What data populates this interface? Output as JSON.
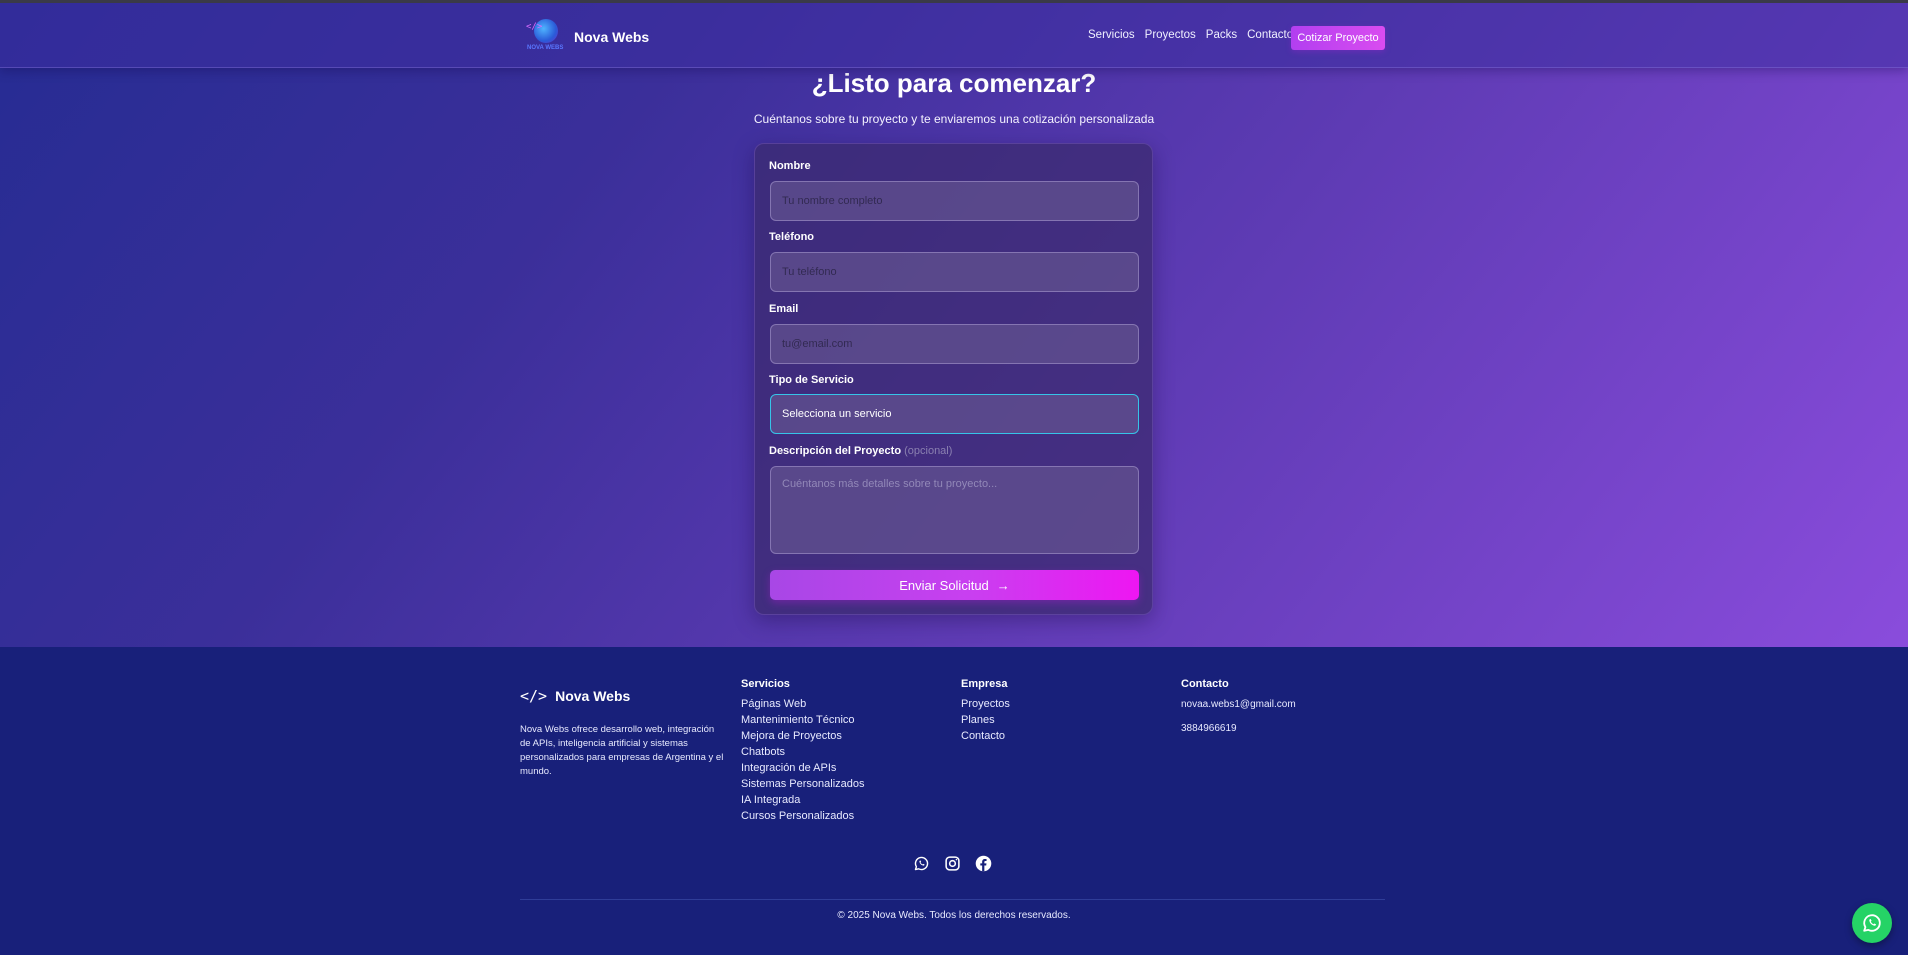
{
  "nav": {
    "brand_name": "Nova Webs",
    "logo_code_glyph": "</>",
    "logo_text": "NOVA WEBS",
    "links": [
      {
        "label": "Servicios"
      },
      {
        "label": "Proyectos"
      },
      {
        "label": "Packs"
      },
      {
        "label": "Contacto"
      }
    ],
    "cta_label": "Cotizar Proyecto"
  },
  "hero": {
    "title": "¿Listo para comenzar?",
    "subtitle": "Cuéntanos sobre tu proyecto y te enviaremos una cotización personalizada"
  },
  "form": {
    "name_label": "Nombre",
    "name_placeholder": "Tu nombre completo",
    "name_value": "",
    "phone_label": "Teléfono",
    "phone_placeholder": "Tu teléfono",
    "phone_value": "",
    "email_label": "Email",
    "email_placeholder": "tu@email.com",
    "email_value": "",
    "service_label": "Tipo de Servicio",
    "service_selected": "Selecciona un servicio",
    "description_label": "Descripción del Proyecto",
    "description_optional": "(opcional)",
    "description_placeholder": "Cuéntanos más detalles sobre tu proyecto...",
    "submit_label": "Enviar Solicitud",
    "submit_arrow": "→"
  },
  "footer": {
    "brand_icon": "</>",
    "brand_name": "Nova Webs",
    "description": "Nova Webs ofrece desarrollo web, integración de APIs, inteligencia artificial y sistemas personalizados para empresas de Argentina y el mundo.",
    "services": {
      "heading": "Servicios",
      "links": [
        {
          "label": "Páginas Web"
        },
        {
          "label": "Mantenimiento Técnico"
        },
        {
          "label": "Mejora de Proyectos"
        },
        {
          "label": "Chatbots"
        },
        {
          "label": "Integración de APIs"
        },
        {
          "label": "Sistemas Personalizados"
        },
        {
          "label": "IA Integrada"
        },
        {
          "label": "Cursos Personalizados"
        }
      ]
    },
    "company": {
      "heading": "Empresa",
      "links": [
        {
          "label": "Proyectos"
        },
        {
          "label": "Planes"
        },
        {
          "label": "Contacto"
        }
      ]
    },
    "contact": {
      "heading": "Contacto",
      "email": "novaa.webs1@gmail.com",
      "phone": "3884966619"
    },
    "socials": [
      "whatsapp-icon",
      "instagram-icon",
      "facebook-icon"
    ],
    "copyright": "© 2025 Nova Webs. Todos los derechos reservados."
  },
  "colors": {
    "accent": "#c93ff0",
    "footer_bg": "#18207a",
    "focus_border": "#36c4e8",
    "whatsapp": "#25d366"
  }
}
